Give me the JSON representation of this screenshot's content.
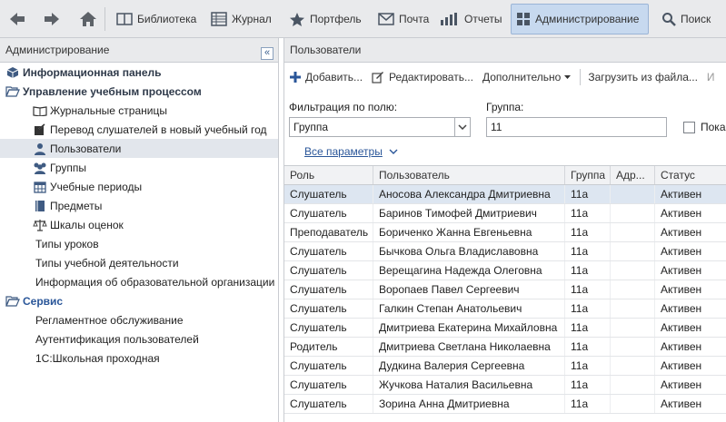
{
  "toolbar": {
    "back_icon": "arrow-left-icon",
    "forward_icon": "arrow-right-icon",
    "home_icon": "home-icon",
    "items": [
      {
        "label": "Библиотека",
        "icon": "book-icon"
      },
      {
        "label": "Журнал",
        "icon": "journal-icon"
      },
      {
        "label": "Портфель",
        "icon": "star-icon"
      },
      {
        "label": "Почта",
        "icon": "mail-icon"
      },
      {
        "label": "Отчеты",
        "icon": "report-icon"
      },
      {
        "label": "Администрирование",
        "icon": "admin-icon"
      },
      {
        "label": "Поиск",
        "icon": "search-icon"
      }
    ],
    "active": "Администрирование"
  },
  "sidebar": {
    "title": "Администрирование",
    "collapse_glyph": "«",
    "items": [
      {
        "label": "Информационная панель"
      },
      {
        "label": "Управление учебным процессом"
      },
      {
        "label": "Журнальные страницы"
      },
      {
        "label": "Перевод слушателей в новый учебный год"
      },
      {
        "label": "Пользователи"
      },
      {
        "label": "Группы"
      },
      {
        "label": "Учебные периоды"
      },
      {
        "label": "Предметы"
      },
      {
        "label": "Шкалы оценок"
      },
      {
        "label": "Типы уроков"
      },
      {
        "label": "Типы учебной деятельности"
      },
      {
        "label": "Информация об образовательной организации"
      },
      {
        "label": "Сервис"
      },
      {
        "label": "Регламентное обслуживание"
      },
      {
        "label": "Аутентификация пользователей"
      },
      {
        "label": "1С:Школьная проходная"
      }
    ]
  },
  "main": {
    "title": "Пользователи",
    "actions": {
      "add": "Добавить...",
      "edit": "Редактировать...",
      "more": "Дополнительно",
      "load": "Загрузить из файла...",
      "cut": "И"
    },
    "filter_label": "Фильтрация по полю:",
    "filter_value": "Группа",
    "group_label": "Группа:",
    "group_value": "11",
    "show_label": "Пока",
    "all_params": "Все параметры"
  },
  "table": {
    "columns": [
      "Роль",
      "Пользователь",
      "Группа",
      "Адр...",
      "Статус"
    ],
    "rows": [
      [
        "Слушатель",
        "Аносова Александра Дмитриевна",
        "11а",
        "",
        "Активен"
      ],
      [
        "Слушатель",
        "Баринов Тимофей Дмитриевич",
        "11а",
        "",
        "Активен"
      ],
      [
        "Преподаватель",
        "Бориченко Жанна Евгеньевна",
        "11а",
        "",
        "Активен"
      ],
      [
        "Слушатель",
        "Бычкова Ольга Владиславовна",
        "11а",
        "",
        "Активен"
      ],
      [
        "Слушатель",
        "Верещагина Надежда Олеговна",
        "11а",
        "",
        "Активен"
      ],
      [
        "Слушатель",
        "Воропаев Павел Сергеевич",
        "11а",
        "",
        "Активен"
      ],
      [
        "Слушатель",
        "Галкин Степан Анатольевич",
        "11а",
        "",
        "Активен"
      ],
      [
        "Слушатель",
        "Дмитриева Екатерина Михайловна",
        "11а",
        "",
        "Активен"
      ],
      [
        "Родитель",
        "Дмитриева Светлана Николаевна",
        "11а",
        "",
        "Активен"
      ],
      [
        "Слушатель",
        "Дудкина Валерия Сергеевна",
        "11а",
        "",
        "Активен"
      ],
      [
        "Слушатель",
        "Жучкова Наталия Васильевна",
        "11а",
        "",
        "Активен"
      ],
      [
        "Слушатель",
        "Зорина Анна Дмитриевна",
        "11а",
        "",
        "Активен"
      ]
    ]
  },
  "colors": {
    "accent": "#2a5699",
    "active_tab": "#c7d9ef",
    "selected_row": "#dde6f1"
  }
}
